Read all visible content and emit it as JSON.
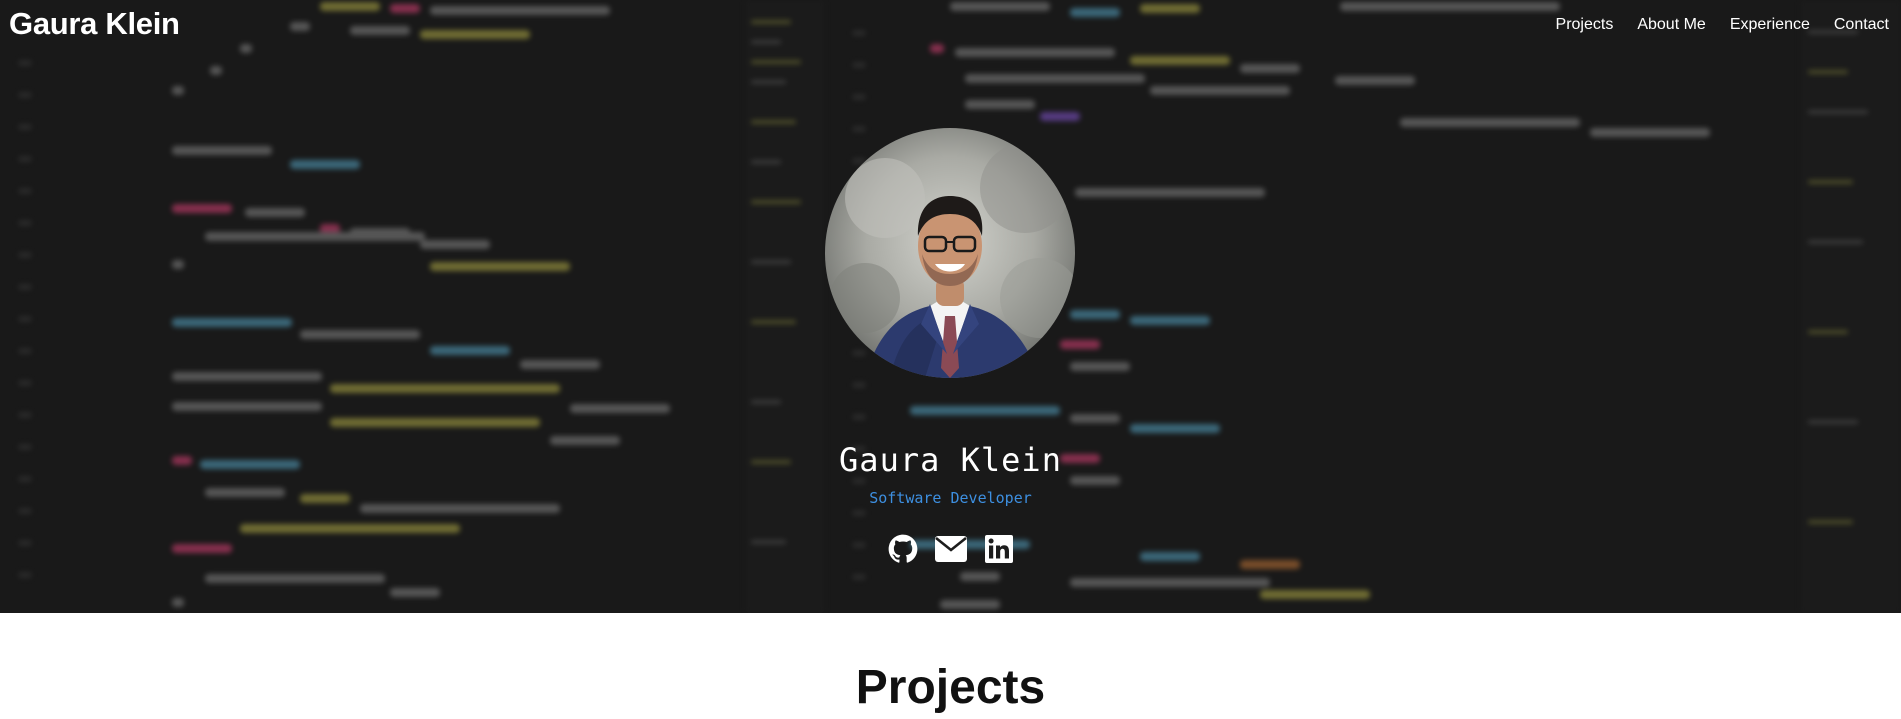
{
  "brand": {
    "name": "Gaura Klein"
  },
  "nav": {
    "items": [
      {
        "label": "Projects"
      },
      {
        "label": "About Me"
      },
      {
        "label": "Experience"
      },
      {
        "label": "Contact"
      }
    ]
  },
  "hero": {
    "name": "Gaura Klein",
    "role": "Software Developer",
    "avatar_icon": "profile-photo",
    "socials": [
      {
        "icon": "github-icon"
      },
      {
        "icon": "envelope-icon"
      },
      {
        "icon": "linkedin-icon"
      }
    ]
  },
  "sections": {
    "projects_title": "Projects"
  },
  "colors": {
    "hero_background": "#1c1c1c",
    "accent": "#3d8fe0",
    "text_light": "#ffffff"
  }
}
